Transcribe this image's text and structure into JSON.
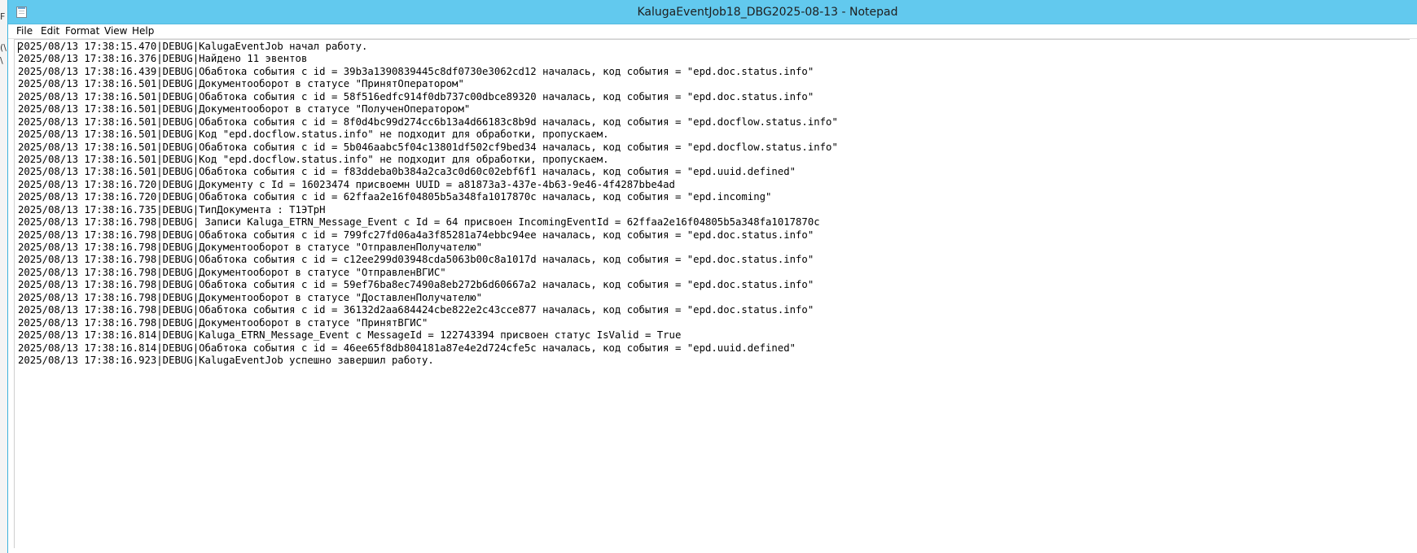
{
  "window": {
    "title": "KalugaEventJob18_DBG2025-08-13 - Notepad",
    "app_icon": "notepad-icon"
  },
  "menu": {
    "items": [
      {
        "label": "File"
      },
      {
        "label": "Edit"
      },
      {
        "label": "Format"
      },
      {
        "label": "View"
      },
      {
        "label": "Help"
      }
    ]
  },
  "background_fragments": [
    "F",
    "(\\",
    "\\"
  ],
  "editor": {
    "lines": [
      "2025/08/13 17:38:15.470|DEBUG|KalugaEventJob начал работу.",
      "2025/08/13 17:38:16.376|DEBUG|Найдено 11 эвентов",
      "2025/08/13 17:38:16.439|DEBUG|Обабтока события с id = 39b3a1390839445c8df0730e3062cd12 началась, код события = \"epd.doc.status.info\"",
      "2025/08/13 17:38:16.501|DEBUG|Документооборот в статусе \"ПринятОператором\"",
      "2025/08/13 17:38:16.501|DEBUG|Обабтока события с id = 58f516edfc914f0db737c00dbce89320 началась, код события = \"epd.doc.status.info\"",
      "2025/08/13 17:38:16.501|DEBUG|Документооборот в статусе \"ПолученОператором\"",
      "2025/08/13 17:38:16.501|DEBUG|Обабтока события с id = 8f0d4bc99d274cc6b13a4d66183c8b9d началась, код события = \"epd.docflow.status.info\"",
      "2025/08/13 17:38:16.501|DEBUG|Код \"epd.docflow.status.info\" не подходит для обработки, пропускаем.",
      "2025/08/13 17:38:16.501|DEBUG|Обабтока события с id = 5b046aabc5f04c13801df502cf9bed34 началась, код события = \"epd.docflow.status.info\"",
      "2025/08/13 17:38:16.501|DEBUG|Код \"epd.docflow.status.info\" не подходит для обработки, пропускаем.",
      "2025/08/13 17:38:16.501|DEBUG|Обабтока события с id = f83ddeba0b384a2ca3c0d60c02ebf6f1 началась, код события = \"epd.uuid.defined\"",
      "2025/08/13 17:38:16.720|DEBUG|Документу с Id = 16023474 присвоемн UUID = a81873a3-437e-4b63-9e46-4f4287bbe4ad",
      "2025/08/13 17:38:16.720|DEBUG|Обабтока события с id = 62ffaa2e16f04805b5a348fa1017870c началась, код события = \"epd.incoming\"",
      "2025/08/13 17:38:16.735|DEBUG|ТипДокумента : Т1ЭТрН",
      "2025/08/13 17:38:16.798|DEBUG| Записи Kaluga_ETRN_Message_Event с Id = 64 присвоен IncomingEventId = 62ffaa2e16f04805b5a348fa1017870c",
      "2025/08/13 17:38:16.798|DEBUG|Обабтока события с id = 799fc27fd06a4a3f85281a74ebbc94ee началась, код события = \"epd.doc.status.info\"",
      "2025/08/13 17:38:16.798|DEBUG|Документооборот в статусе \"ОтправленПолучателю\"",
      "2025/08/13 17:38:16.798|DEBUG|Обабтока события с id = c12ee299d03948cda5063b00c8a1017d началась, код события = \"epd.doc.status.info\"",
      "2025/08/13 17:38:16.798|DEBUG|Документооборот в статусе \"ОтправленВГИС\"",
      "2025/08/13 17:38:16.798|DEBUG|Обабтока события с id = 59ef76ba8ec7490a8eb272b6d60667a2 началась, код события = \"epd.doc.status.info\"",
      "2025/08/13 17:38:16.798|DEBUG|Документооборот в статусе \"ДоставленПолучателю\"",
      "2025/08/13 17:38:16.798|DEBUG|Обабтока события с id = 36132d2aa684424cbe822e2c43cce877 началась, код события = \"epd.doc.status.info\"",
      "2025/08/13 17:38:16.798|DEBUG|Документооборот в статусе \"ПринятВГИС\"",
      "2025/08/13 17:38:16.814|DEBUG|Kaluga_ETRN_Message_Event с MessageId = 122743394 присвоен статус IsValid = True",
      "2025/08/13 17:38:16.814|DEBUG|Обабтока события с id = 46ee65f8db804181a87e4e2d724cfe5c началась, код события = \"epd.uuid.defined\"",
      "2025/08/13 17:38:16.923|DEBUG|KalugaEventJob успешно завершил работу."
    ]
  }
}
